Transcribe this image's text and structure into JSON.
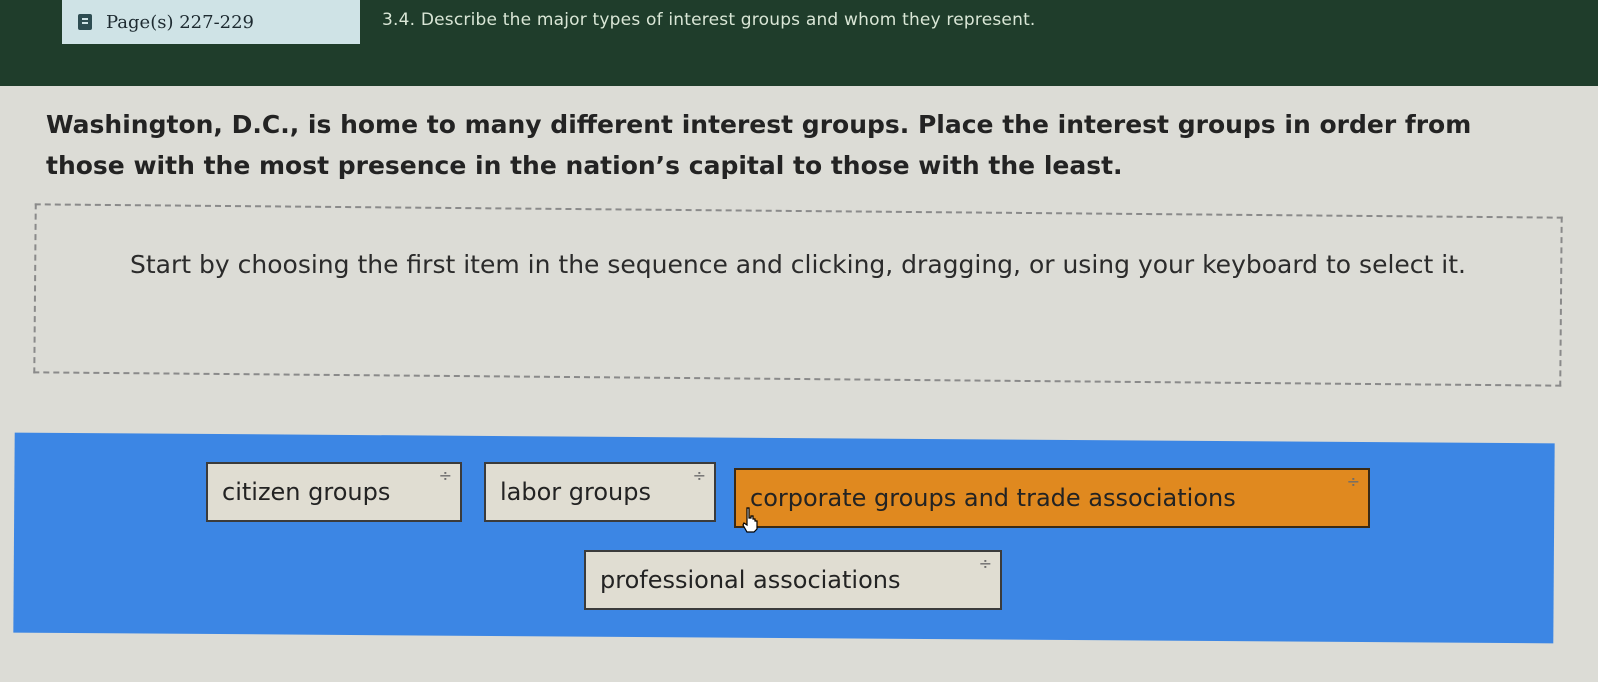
{
  "header": {
    "page_ref": "Page(s) 227-229",
    "objective": "3.4. Describe the major types of interest groups and whom they represent."
  },
  "prompt": "Washington, D.C., is home to many different interest groups. Place the interest groups in order from those with the most presence in the nation’s capital to those with the least.",
  "instructions": "Start by choosing the first item in the sequence and clicking, dragging, or using your keyboard to select it.",
  "items": [
    {
      "label": "citizen groups",
      "selected": false
    },
    {
      "label": "labor groups",
      "selected": false
    },
    {
      "label": "corporate groups and trade associations",
      "selected": true
    },
    {
      "label": "professional associations",
      "selected": false
    }
  ],
  "drag_glyph": "÷",
  "colors": {
    "header_bg": "#1f3d2b",
    "tray_bg": "#3c86e4",
    "selected_item": "#e0891f",
    "item_bg": "#e0ddd2"
  },
  "icons": {
    "page": "book-icon",
    "drag": "drag-handle-icon",
    "pointer": "hand-pointer-icon"
  }
}
